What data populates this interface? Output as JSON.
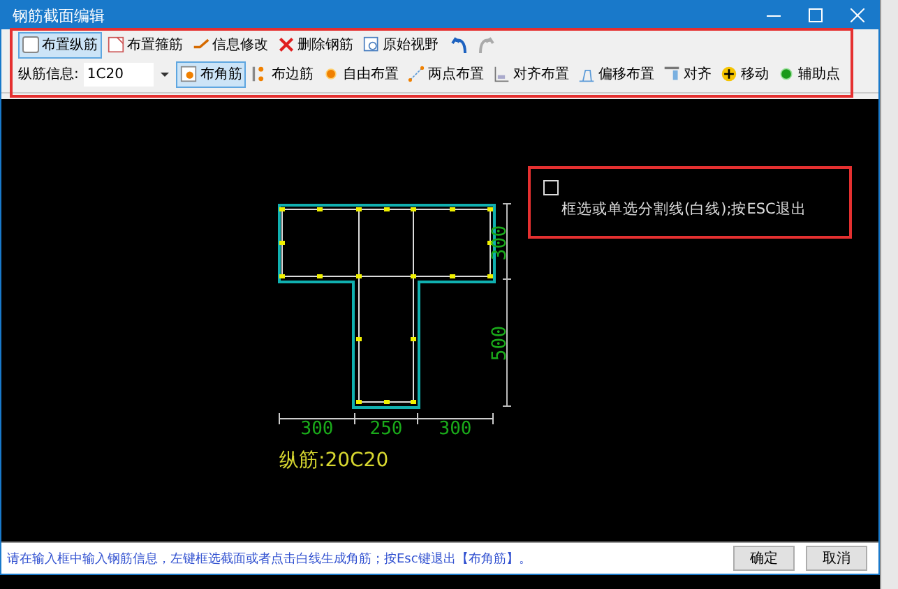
{
  "window": {
    "title": "钢筋截面编辑"
  },
  "toolbar_1": [
    {
      "label": "布置纵筋",
      "kind": "square",
      "selected": true
    },
    {
      "label": "布置箍筋",
      "kind": "stirrup",
      "selected": false
    },
    {
      "label": "信息修改",
      "kind": "edit",
      "selected": false
    },
    {
      "label": "删除钢筋",
      "kind": "cross",
      "selected": false
    },
    {
      "label": "原始视野",
      "kind": "view",
      "selected": false
    }
  ],
  "history": [
    {
      "kind": "undo",
      "disabled": false
    },
    {
      "kind": "redo",
      "disabled": true
    }
  ],
  "rebar_info": {
    "label": "纵筋信息:",
    "value": "1C20"
  },
  "toolbar_2": [
    {
      "label": "布角筋",
      "kind": "corner",
      "selected": true
    },
    {
      "label": "布边筋",
      "kind": "edge",
      "selected": false
    },
    {
      "label": "自由布置",
      "kind": "dot",
      "selected": false
    },
    {
      "label": "两点布置",
      "kind": "twopoint",
      "selected": false
    },
    {
      "label": "对齐布置",
      "kind": "align",
      "selected": false
    },
    {
      "label": "偏移布置",
      "kind": "offset",
      "selected": false
    },
    {
      "label": "对齐",
      "kind": "alignbar",
      "selected": false
    },
    {
      "label": "移动",
      "kind": "move",
      "selected": false
    },
    {
      "label": "辅助点",
      "kind": "greendot",
      "selected": false
    }
  ],
  "drawing": {
    "dims_vertical": [
      "300",
      "500"
    ],
    "dims_horizontal": [
      "300",
      "250",
      "300"
    ],
    "rebar_label": "纵筋:20C20"
  },
  "prompt": {
    "checked": false,
    "text": "框选或单选分割线(白线);按ESC退出"
  },
  "status_bar": {
    "message": "请在输入框中输入钢筋信息，左键框选截面或者点击白线生成角筋；按Esc键退出【布角筋】。",
    "buttons": [
      "确定",
      "取消"
    ]
  }
}
